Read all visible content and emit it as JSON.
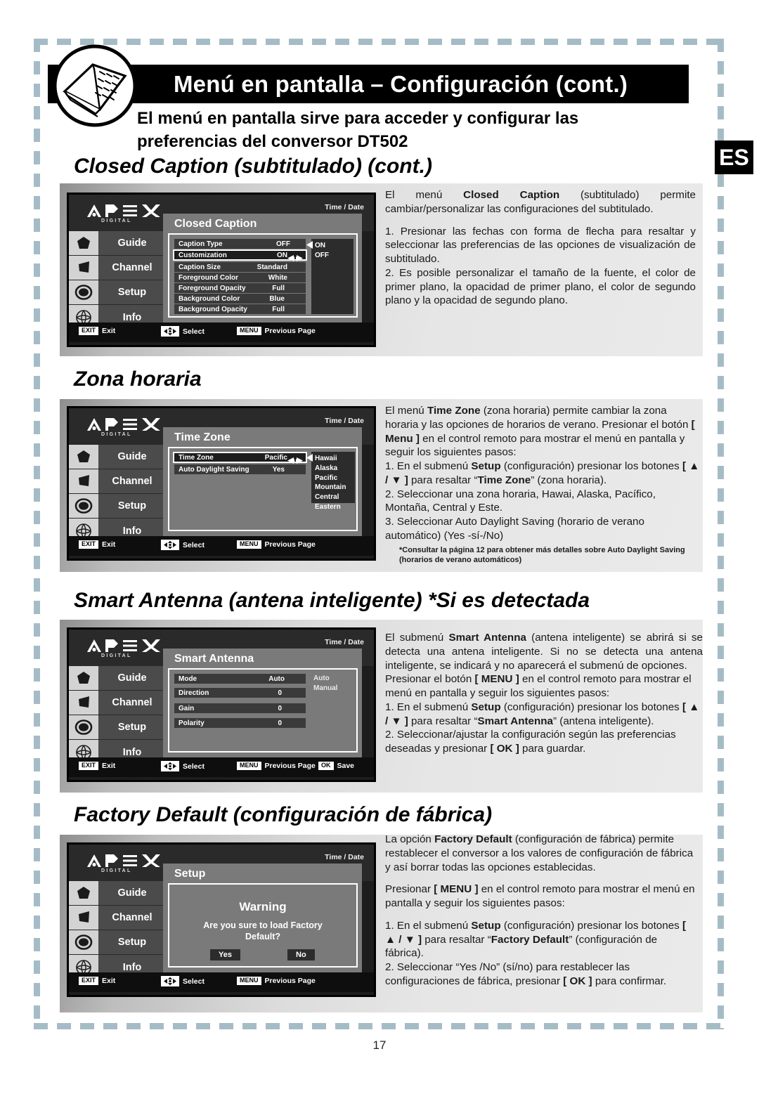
{
  "header": {
    "title": "Menú en pantalla – Configuración (cont.)",
    "intro_line1": "El menú en pantalla sirve para acceder y configurar las",
    "intro_line2": "preferencias del conversor DT502",
    "language_badge": "ES",
    "book_icon": "open-book-icon"
  },
  "page_number": "17",
  "osd_common": {
    "brand": "APEX",
    "brand_sub": "DIGITAL",
    "time_date": "Time / Date",
    "sidebar": [
      {
        "label": "Guide",
        "icon": "pentagon-icon"
      },
      {
        "label": "Channel",
        "icon": "quad-icon"
      },
      {
        "label": "Setup",
        "icon": "ring-icon"
      },
      {
        "label": "Info",
        "icon": "ball-icon"
      }
    ],
    "footer": {
      "exit_key": "EXIT",
      "exit_label": "Exit",
      "select_label": "Select",
      "menu_key": "MENU",
      "menu_label": "Previous Page",
      "ok_key": "OK",
      "ok_label": "Save"
    }
  },
  "sections": [
    {
      "heading": "Closed Caption (subtitulado) (cont.)",
      "osd": {
        "title": "Closed Caption",
        "rows": [
          {
            "key": "Caption Type",
            "value": "OFF",
            "highlighted": false
          },
          {
            "key": "Customization",
            "value": "ON",
            "highlighted": true,
            "arrows": true
          },
          {
            "key": "Caption Size",
            "value": "Standard",
            "highlighted": false
          },
          {
            "key": "Foreground Color",
            "value": "White",
            "highlighted": false
          },
          {
            "key": "Foreground Opacity",
            "value": "Full",
            "highlighted": false
          },
          {
            "key": "Background Color",
            "value": "Blue",
            "highlighted": false
          },
          {
            "key": "Background Opacity",
            "value": "Full",
            "highlighted": false
          }
        ],
        "options": [
          "ON",
          "OFF"
        ]
      },
      "paragraphs": [
        "El menú Closed Caption (subtitulado) permite cambiar/personalizar las configuraciones del subtitulado.",
        "1. Presionar las fechas con forma de flecha para resaltar y seleccionar las preferencias de las opciones de visualización de subtitulado.",
        "2. Es posible personalizar el tamaño de la fuente, el color de primer plano, la opacidad de primer plano, el color de segundo plano y la opacidad de segundo plano."
      ]
    },
    {
      "heading": "Zona horaria",
      "osd": {
        "title": "Time Zone",
        "rows": [
          {
            "key": "Time Zone",
            "value": "Pacific",
            "highlighted": true,
            "arrows": true
          },
          {
            "key": "Auto Daylight Saving",
            "value": "Yes",
            "highlighted": false
          }
        ],
        "options": [
          "Hawaii",
          "Alaska",
          "Pacific",
          "Mountain",
          "Central",
          "Eastern"
        ]
      },
      "paragraphs": [
        "El menú Time Zone (zona horaria) permite cambiar la zona horaria y las opciones de horarios de verano. Presionar el botón [ Menu ] en el control remoto para mostrar el menú en pantalla y seguir los siguientes pasos:",
        "1. En el submenú Setup (configuración) presionar los botones [ ▲ / ▼ ] para resaltar “Time Zone” (zona horaria).",
        "2. Seleccionar una zona horaria, Hawai, Alaska, Pacífico, Montaña, Central y Este.",
        "3. Seleccionar Auto Daylight Saving (horario de verano automático) (Yes -sí-/No)"
      ],
      "footnote": "*Consultar la página 12 para obtener más detalles sobre Auto Daylight Saving (horarios de verano automáticos)"
    },
    {
      "heading": "Smart Antenna (antena inteligente) *Si es detectada",
      "osd": {
        "title": "Smart Antenna",
        "rows": [
          {
            "key": "Mode",
            "value": "Auto",
            "highlighted": false
          },
          {
            "key": "Direction",
            "value": "0",
            "highlighted": false
          },
          {
            "key": "Gain",
            "value": "0",
            "highlighted": false
          },
          {
            "key": "Polarity",
            "value": "0",
            "highlighted": false
          }
        ],
        "options": [
          "Auto",
          "Manual"
        ],
        "has_ok_save": true
      },
      "paragraphs": [
        "El submenú Smart Antenna (antena inteligente) se abrirá si se detecta una antena inteligente. Si no se detecta una antena inteligente, se indicará y no aparecerá el submenú de opciones.",
        "Presionar el botón [ MENU ] en el control remoto para mostrar el menú en pantalla y seguir los siguientes pasos:",
        "1. En el submenú Setup (configuración) presionar los botones [ ▲ / ▼ ] para resaltar “Smart Antenna” (antena inteligente).",
        "2. Seleccionar/ajustar la configuración según las preferencias deseadas y presionar [ OK ] para guardar."
      ]
    },
    {
      "heading": "Factory Default (configuración de fábrica)",
      "osd": {
        "title": "Setup",
        "dialog": {
          "title": "Warning",
          "message": "Are you sure to load Factory Default?",
          "yes": "Yes",
          "no": "No"
        }
      },
      "paragraphs": [
        "La opción Factory Default (configuración de fábrica) permite restablecer el conversor a los valores de configuración de fábrica y así borrar todas las opciones establecidas.",
        "Presionar [ MENU ] en el control remoto para mostrar el menú en pantalla y seguir los siguientes pasos:",
        "1. En el submenú Setup (configuración) presionar los botones [ ▲ / ▼ ] para resaltar “Factory Default” (configuración de fábrica).",
        "2. Seleccionar “Yes /No” (sí/no) para restablecer las configuraciones de fábrica, presionar [ OK ] para confirmar."
      ]
    }
  ],
  "colors": {
    "dash_border": "#a5bcc6",
    "header_band": "#000000",
    "panel_light": "#e8e8e8",
    "panel_dark": "#9a9a9a",
    "osd_panel": "#7a7a7a",
    "osd_row": "#3a3a3a"
  }
}
